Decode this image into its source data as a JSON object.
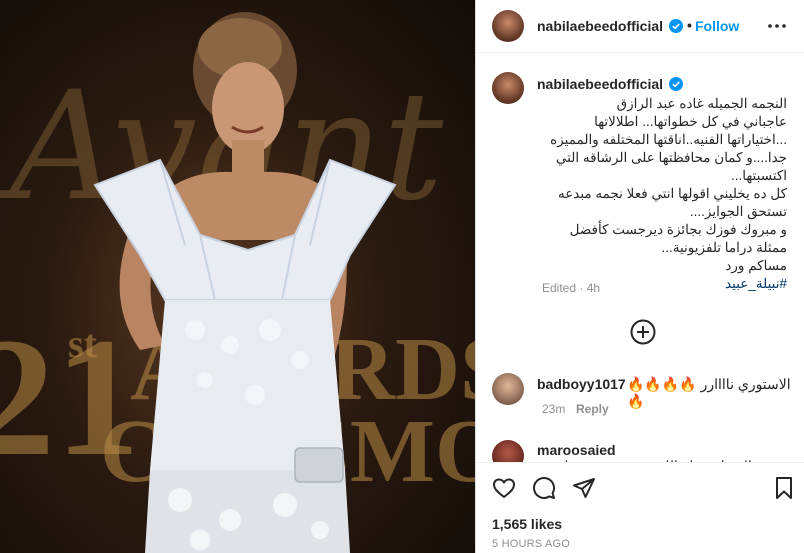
{
  "photo": {
    "alt_words": {
      "script": "Avant Garde",
      "big": "21st AWARDS CEREMONY"
    }
  },
  "header": {
    "username": "nabilaebeedofficial",
    "dot": "•",
    "follow_label": "Follow"
  },
  "caption": {
    "username": "nabilaebeedofficial",
    "text": "النجمه الجميله غاده عبد الرازق\nعاجباني في كل خطواتها... اطلالاتها ...اختياراتها الفنيه..اناقتها المختلفه والمميزه جدا....و كمان محافظتها على الرشاقه التي اكتسبتها...\nكل ده يخليني اقولها انتي فعلا نجمه مبدعه تستحق الجوايز....\nو مبروك فوزك بجائزة ديرجست كأفضل ممثلة دراما تلفزيونية...\nمساكم ورد",
    "hashtag": "#نبيلة_عبيد",
    "edited": "Edited · 4h"
  },
  "comments": [
    {
      "username": "badboyy1017",
      "text": "الاستوري ناااارر 🔥🔥🔥🔥🔥",
      "time": "23m",
      "reply_label": "Reply"
    },
    {
      "username": "maroosaied",
      "text": "الديزاين حلو اللون وحش وهي بتلبس"
    }
  ],
  "footer": {
    "likes": "1,565 likes",
    "time": "5 HOURS AGO"
  },
  "icons": {
    "verified": "verified-badge-icon",
    "more": "more-options-icon",
    "load_more": "plus-circle-icon",
    "like": "heart-icon",
    "comment": "comment-icon",
    "share": "share-icon",
    "save": "bookmark-icon"
  },
  "colors": {
    "accent": "#0095f6",
    "verified": "#0095f6",
    "hashtag": "#00376b",
    "muted": "#8e8e8e"
  }
}
